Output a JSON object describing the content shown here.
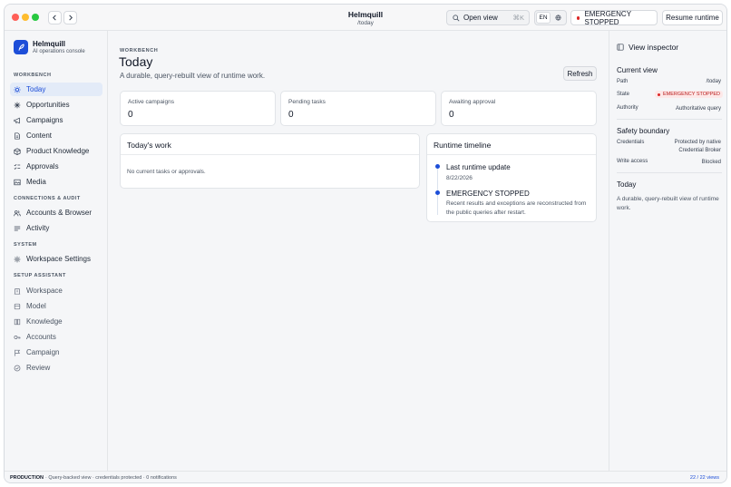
{
  "window": {
    "title": "Helmquill",
    "path": "/today"
  },
  "toolbar": {
    "open_view_label": "Open view",
    "open_view_shortcut": "⌘K",
    "lang_active": "EN",
    "lang_icon": "globe-icon",
    "emergency_label": "EMERGENCY STOPPED",
    "resume_label": "Resume runtime"
  },
  "brand": {
    "name": "Helmquill",
    "subtitle": "AI operations console"
  },
  "sidebar": {
    "workbench_label": "WORKBENCH",
    "workbench_items": [
      {
        "label": "Today",
        "icon": "sun-icon",
        "active": true
      },
      {
        "label": "Opportunities",
        "icon": "sparkle-icon"
      },
      {
        "label": "Campaigns",
        "icon": "megaphone-icon"
      },
      {
        "label": "Content",
        "icon": "document-icon"
      },
      {
        "label": "Product Knowledge",
        "icon": "box-icon"
      },
      {
        "label": "Approvals",
        "icon": "checklist-icon"
      },
      {
        "label": "Media",
        "icon": "image-icon"
      }
    ],
    "connections_label": "CONNECTIONS & AUDIT",
    "connections_items": [
      {
        "label": "Accounts & Browser",
        "icon": "users-icon"
      },
      {
        "label": "Activity",
        "icon": "list-icon"
      }
    ],
    "system_label": "SYSTEM",
    "system_items": [
      {
        "label": "Workspace Settings",
        "icon": "gear-icon"
      }
    ],
    "setup_label": "SETUP ASSISTANT",
    "setup_items": [
      {
        "label": "Workspace",
        "icon": "building-icon"
      },
      {
        "label": "Model",
        "icon": "cube-icon"
      },
      {
        "label": "Knowledge",
        "icon": "book-icon"
      },
      {
        "label": "Accounts",
        "icon": "key-icon"
      },
      {
        "label": "Campaign",
        "icon": "flag-icon"
      },
      {
        "label": "Review",
        "icon": "check-circle-icon"
      }
    ]
  },
  "main": {
    "eyebrow": "WORKBENCH",
    "title": "Today",
    "description": "A durable, query-rebuilt view of runtime work.",
    "refresh_label": "Refresh",
    "stats": [
      {
        "label": "Active campaigns",
        "value": "0"
      },
      {
        "label": "Pending tasks",
        "value": "0"
      },
      {
        "label": "Awaiting approval",
        "value": "0"
      }
    ],
    "todays_work": {
      "title": "Today's work",
      "empty": "No current tasks or approvals."
    },
    "timeline": {
      "title": "Runtime timeline",
      "items": [
        {
          "title": "Last runtime update",
          "text": "8/22/2026"
        },
        {
          "title": "EMERGENCY STOPPED",
          "text": "Recent results and exceptions are reconstructed from the public queries after restart."
        }
      ]
    }
  },
  "inspector": {
    "title": "View inspector",
    "current_view_title": "Current view",
    "path_key": "Path",
    "path_val": "/today",
    "state_key": "State",
    "state_val": "EMERGENCY STOPPED",
    "authority_key": "Authority",
    "authority_val": "Authoritative query",
    "safety_title": "Safety boundary",
    "credentials_key": "Credentials",
    "credentials_val": "Protected by native Credential Broker",
    "write_key": "Write access",
    "write_val": "Blocked",
    "today_title": "Today",
    "today_desc": "A durable, query-rebuilt view of runtime work."
  },
  "statusbar": {
    "env": "PRODUCTION",
    "text": "· Query-backed view · credentials protected · 0 notifications",
    "views": "22 / 22 views"
  },
  "colors": {
    "accent": "#1d4ed8",
    "danger": "#dc2626",
    "active_bg": "#e3ebf8"
  }
}
